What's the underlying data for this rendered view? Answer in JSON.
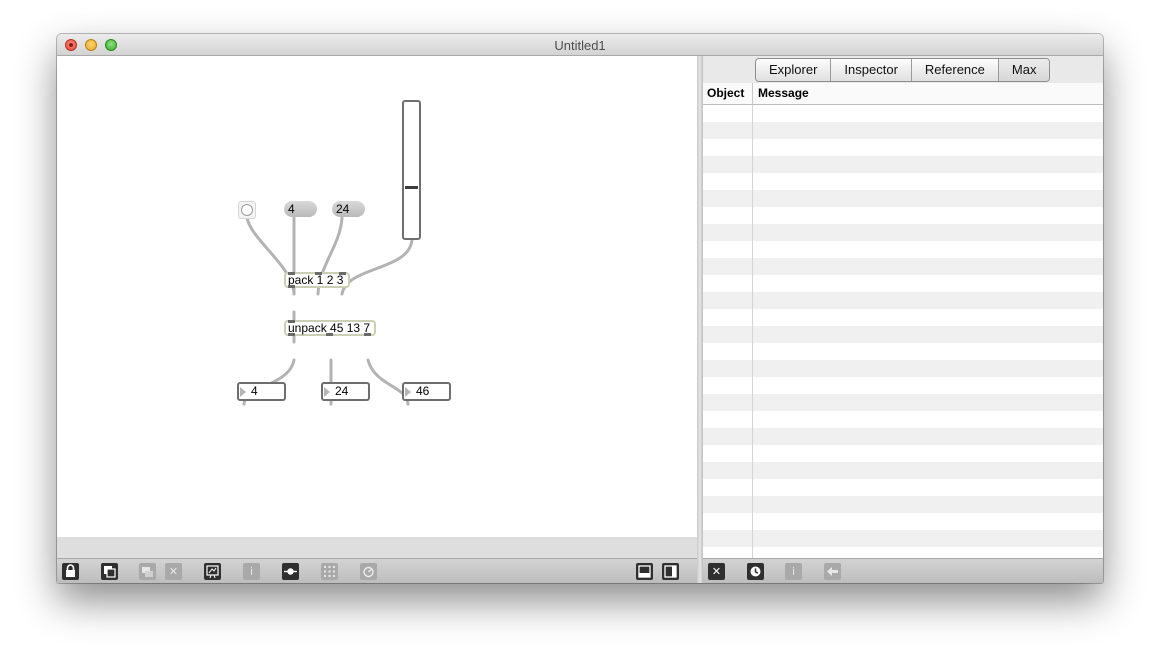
{
  "window": {
    "title": "Untitled1"
  },
  "patcher": {
    "message_boxes": [
      {
        "label": "4"
      },
      {
        "label": "24"
      }
    ],
    "objects": {
      "pack": "pack 1 2 3",
      "unpack": "unpack 45 13 7"
    },
    "number_boxes": [
      {
        "value": "4"
      },
      {
        "value": "24"
      },
      {
        "value": "46"
      }
    ],
    "toggle": {
      "state": "off"
    }
  },
  "sidebar": {
    "tabs": [
      {
        "label": "Explorer"
      },
      {
        "label": "Inspector"
      },
      {
        "label": "Reference"
      },
      {
        "label": "Max"
      }
    ],
    "table": {
      "columns": [
        "Object",
        "Message"
      ],
      "rows": []
    }
  },
  "icons": {
    "patch_toolbar": [
      "lock-icon",
      "presentation-toggle-icon",
      "stack-icon",
      "close-x-icon",
      "paint-icon",
      "info-icon",
      "slider-object-icon",
      "grid-icon",
      "debug-icon"
    ],
    "view_toggles": [
      "bottom-panel-icon",
      "side-panel-icon"
    ],
    "sidebar_toolbar": [
      "clear-icon",
      "clock-icon",
      "info-icon",
      "back-arrow-icon"
    ]
  },
  "colors": {
    "titlebar": "#d6d6d6",
    "toolbar": "#c7c7c7",
    "object_border": "#c8cfb2"
  }
}
